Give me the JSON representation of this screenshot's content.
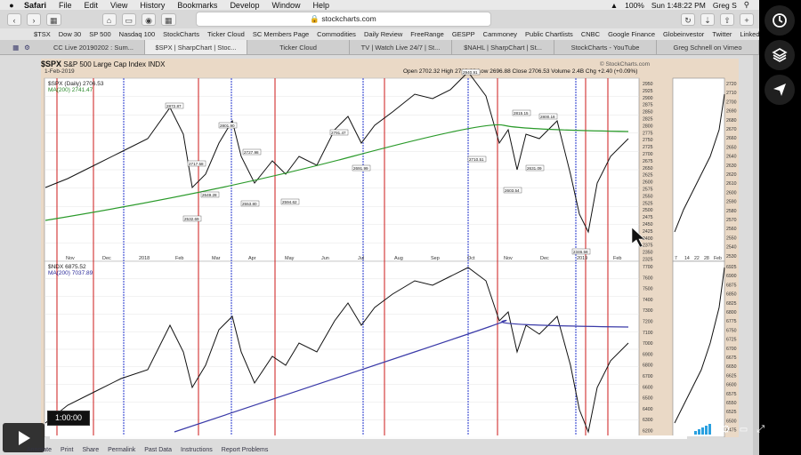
{
  "menubar": {
    "app": "Safari",
    "items": [
      "File",
      "Edit",
      "View",
      "History",
      "Bookmarks",
      "Develop",
      "Window",
      "Help"
    ],
    "battery": "100%",
    "clock": "Sun 1:48:22 PM",
    "user": "Greg S"
  },
  "toolbar": {
    "url": "stockcharts.com"
  },
  "bookmarks": [
    "$TSX",
    "Dow 30",
    "SP 500",
    "Nasdaq 100",
    "StockCharts",
    "Ticker Cloud",
    "SC Members Page",
    "Commodities",
    "Daily Review",
    "FreeRange",
    "GESPP",
    "Cammoney",
    "Public Chartlists",
    "CNBC",
    "Google Finance",
    "Globeinvestor",
    "Twitter",
    "LinkedIn"
  ],
  "tabs": [
    "CC Live 20190202 : Sum...",
    "$SPX | SharpChart | Stoc...",
    "Ticker Cloud",
    "TV | Watch Live 24/7 | St...",
    "$NAHL | SharpChart | St...",
    "StockCharts - YouTube",
    "Greg Schnell on Vimeo"
  ],
  "chart": {
    "title_symbol": "$SPX",
    "title_text": "S&P 500 Large Cap Index",
    "exchange": "INDX",
    "date": "1-Feb-2019",
    "ohlc": "Open 2702.32   High 2716.66   Low 2696.88   Close 2706.53   Volume 2.4B   Chg +2.40 (+0.09%)",
    "logo": "© StockCharts.com",
    "top_legend_1": "$SPX (Daily) 2706.53",
    "top_legend_2": "MA(200) 2741.47",
    "bottom_legend_1": "$NDX 6875.52",
    "bottom_legend_2": "MA(200) 7037.89",
    "x_labels": [
      "Nov",
      "Dec",
      "2018",
      "Feb",
      "Mar",
      "Apr",
      "May",
      "Jun",
      "Jul",
      "Aug",
      "Sep",
      "Oct",
      "Nov",
      "Dec",
      "2019",
      "Feb"
    ],
    "top_ticks": [
      "2950",
      "2925",
      "2900",
      "2875",
      "2850",
      "2825",
      "2800",
      "2775",
      "2750",
      "2725",
      "2700",
      "2675",
      "2650",
      "2625",
      "2600",
      "2575",
      "2550",
      "2525",
      "2500",
      "2475",
      "2450",
      "2425",
      "2400",
      "2375",
      "2350",
      "2325"
    ],
    "right_top_ticks": [
      "2720",
      "2710",
      "2700",
      "2690",
      "2680",
      "2670",
      "2660",
      "2650",
      "2640",
      "2630",
      "2620",
      "2610",
      "2600",
      "2590",
      "2580",
      "2570",
      "2560",
      "2550",
      "2540",
      "2530"
    ],
    "bottom_ticks": [
      "7700",
      "7600",
      "7500",
      "7400",
      "7300",
      "7200",
      "7100",
      "7000",
      "6900",
      "6800",
      "6700",
      "6600",
      "6500",
      "6400",
      "6300",
      "6200"
    ],
    "right_bottom_ticks": [
      "6925",
      "6900",
      "6875",
      "6850",
      "6825",
      "6800",
      "6775",
      "6750",
      "6725",
      "6700",
      "6675",
      "6650",
      "6625",
      "6600",
      "6575",
      "6550",
      "6525",
      "6500",
      "6475"
    ],
    "mini_x_labels": [
      "7",
      "14",
      "22",
      "28",
      "Feb"
    ],
    "annotations": [
      "2872.87",
      "2801.90",
      "2717.58",
      "2649.28",
      "2532.69",
      "2727.98",
      "2553.80",
      "2594.62",
      "2791.47",
      "2691.99",
      "2940.91",
      "2710.51",
      "2603.54",
      "2815.15",
      "2631.09",
      "2800.18",
      "2346.58"
    ]
  },
  "video": {
    "time": "1:00:00",
    "progress_fraction": 1.0
  },
  "footer": [
    "Annotate",
    "Print",
    "Share",
    "Permalink",
    "Past Data",
    "Instructions",
    "Report Problems"
  ]
}
